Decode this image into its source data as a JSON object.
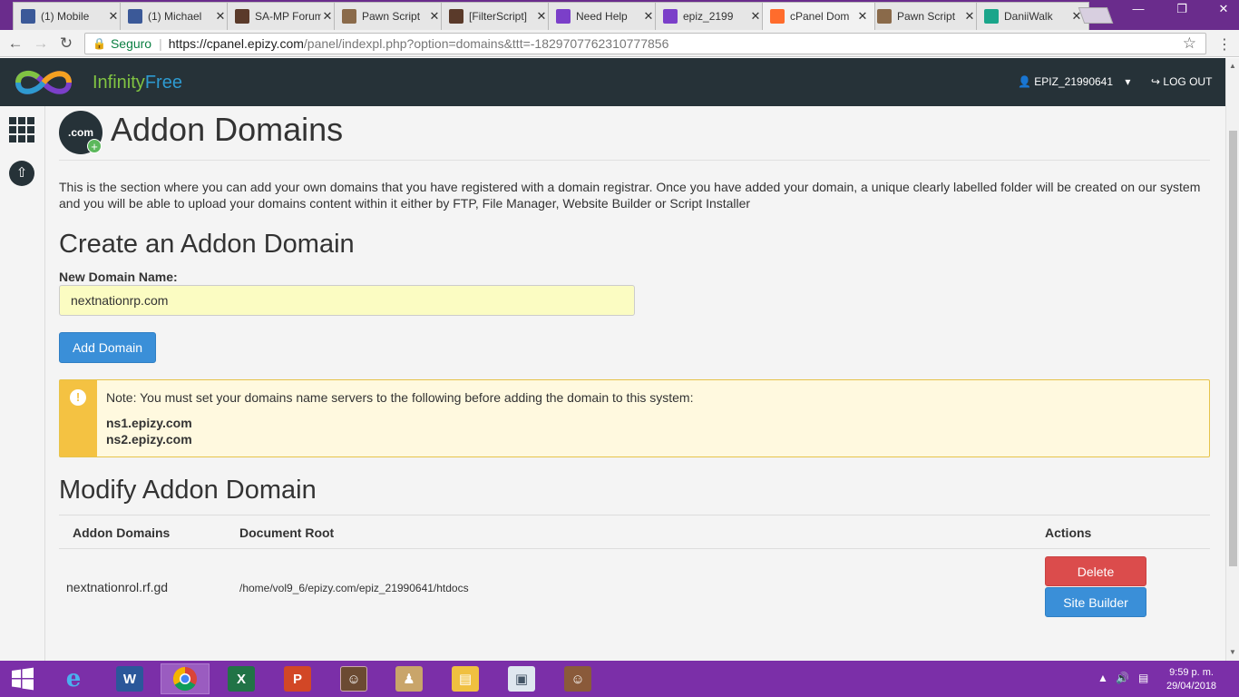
{
  "browser": {
    "tabs": [
      {
        "label": "(1) Mobile",
        "icon": "facebook-icon",
        "color": "#3b5998"
      },
      {
        "label": "(1) Michael",
        "icon": "facebook-icon",
        "color": "#3b5998"
      },
      {
        "label": "SA-MP Forum",
        "icon": "samp-icon",
        "color": "#5a3a2a"
      },
      {
        "label": "Pawn Script",
        "icon": "pawn-icon",
        "color": "#8a6a4a"
      },
      {
        "label": "[FilterScript]",
        "icon": "samp-icon",
        "color": "#5a3a2a"
      },
      {
        "label": "Need Help",
        "icon": "infinity-icon",
        "color": "#7b3fc9"
      },
      {
        "label": "epiz_2199",
        "icon": "infinity-icon",
        "color": "#7b3fc9"
      },
      {
        "label": "cPanel Dom",
        "icon": "cpanel-icon",
        "color": "#ff6c2c"
      },
      {
        "label": "Pawn Script",
        "icon": "pawn-icon",
        "color": "#8a6a4a"
      },
      {
        "label": "DaniiWalk",
        "icon": "app-icon",
        "color": "#1aa58a"
      }
    ],
    "secure_label": "Seguro",
    "url_host": "https://cpanel.epizy.com",
    "url_rest": "/panel/indexpl.php?option=domains&ttt=-1829707762310777856"
  },
  "header": {
    "brand_a": "Infinity",
    "brand_b": "Free",
    "user": "EPIZ_21990641",
    "logout": "LOG OUT"
  },
  "main": {
    "icon_text": ".com",
    "title": "Addon Domains",
    "description": "This is the section where you can add your own domains that you have registered with a domain registrar. Once you have added your domain, a unique clearly labelled folder will be created on our system and you will be able to upload your domains content within it either by FTP, File Manager, Website Builder or Script Installer",
    "create_heading": "Create an Addon Domain",
    "new_domain_label": "New Domain Name:",
    "new_domain_value": "nextnationrp.com",
    "add_button": "Add Domain",
    "note_text": "Note: You must set your domains name servers to the following before adding the domain to this system:",
    "ns1": "ns1.epizy.com",
    "ns2": "ns2.epizy.com",
    "modify_heading": "Modify Addon Domain",
    "table": {
      "headers": [
        "Addon Domains",
        "Document Root",
        "Actions"
      ],
      "rows": [
        {
          "domain": "nextnationrol.rf.gd",
          "root": "/home/vol9_6/epizy.com/epiz_21990641/htdocs",
          "delete": "Delete",
          "builder": "Site Builder"
        }
      ]
    }
  },
  "taskbar": {
    "time": "9:59 p. m.",
    "date": "29/04/2018"
  }
}
